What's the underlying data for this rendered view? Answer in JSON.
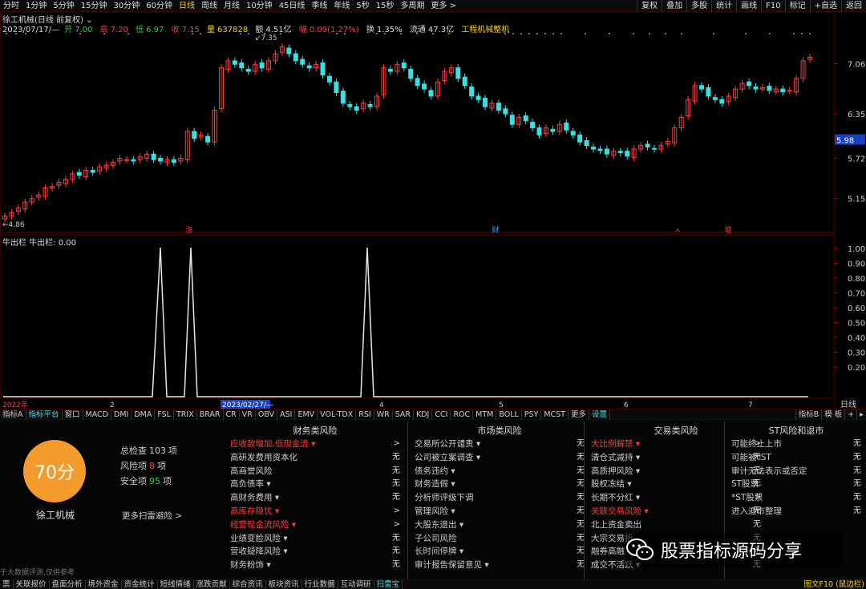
{
  "timeframes": [
    {
      "label": "分时",
      "active": false
    },
    {
      "label": "1分钟",
      "active": false
    },
    {
      "label": "5分钟",
      "active": false
    },
    {
      "label": "15分钟",
      "active": false
    },
    {
      "label": "30分钟",
      "active": false
    },
    {
      "label": "60分钟",
      "active": false
    },
    {
      "label": "日线",
      "active": true
    },
    {
      "label": "周线",
      "active": false
    },
    {
      "label": "月线",
      "active": false
    },
    {
      "label": "10分钟",
      "active": false
    },
    {
      "label": "45日线",
      "active": false
    },
    {
      "label": "季线",
      "active": false
    },
    {
      "label": "年线",
      "active": false
    },
    {
      "label": "5秒",
      "active": false
    },
    {
      "label": "15秒",
      "active": false
    },
    {
      "label": "多周期",
      "active": false
    },
    {
      "label": "更多 >",
      "active": false
    }
  ],
  "toolbar_right": [
    "复权",
    "叠加",
    "多股",
    "统计",
    "画线",
    "F10",
    "标记",
    "+自选",
    "返回"
  ],
  "stock_title": "徐工机械(日线 前复权) ⌄",
  "quote": {
    "date": "2023/07/17/—",
    "open_label": "开",
    "open": "7.00",
    "high_label": "高",
    "high": "7.20",
    "low_label": "低",
    "low": "6.97",
    "close_label": "收",
    "close": "7.15",
    "volume_label": "量",
    "volume": "637828",
    "amount_label": "额",
    "amount": "4.51亿",
    "change_label": "幅",
    "change": "0.09(1.27%)",
    "turnover_label": "换",
    "turnover": "1.35%",
    "float_label": "流通",
    "float": "47.3亿",
    "sector": "工程机械整机"
  },
  "price_axis": [
    "7.06",
    "6.35",
    "5.98",
    "5.72",
    "5.15"
  ],
  "price_marks": {
    "high": "7.35",
    "low": "4.86"
  },
  "event_marks": [
    "涨",
    "财",
    "ㅅ",
    "增"
  ],
  "indicator_title": "牛出栏  牛出栏: 0.00",
  "indicator_axis": [
    "1.00",
    "0.90",
    "0.80",
    "0.70",
    "0.60",
    "0.50",
    "0.40",
    "0.30",
    "0.20"
  ],
  "time_axis": {
    "start": "2022年",
    "labels": [
      "2",
      "2023/02/27/—",
      "4",
      "5",
      "6",
      "7"
    ],
    "right": "日线"
  },
  "indicator_tabs": [
    {
      "label": "指标A",
      "cls": ""
    },
    {
      "label": "指标平台",
      "cls": "active"
    },
    {
      "label": "窗口",
      "cls": ""
    },
    {
      "label": "MACD",
      "cls": ""
    },
    {
      "label": "DMI",
      "cls": ""
    },
    {
      "label": "DMA",
      "cls": ""
    },
    {
      "label": "FSL",
      "cls": ""
    },
    {
      "label": "TRIX",
      "cls": ""
    },
    {
      "label": "BRAR",
      "cls": ""
    },
    {
      "label": "CR",
      "cls": ""
    },
    {
      "label": "VR",
      "cls": ""
    },
    {
      "label": "OBV",
      "cls": ""
    },
    {
      "label": "ASI",
      "cls": ""
    },
    {
      "label": "EMV",
      "cls": ""
    },
    {
      "label": "VOL-TDX",
      "cls": ""
    },
    {
      "label": "RSI",
      "cls": ""
    },
    {
      "label": "WR",
      "cls": ""
    },
    {
      "label": "SAR",
      "cls": ""
    },
    {
      "label": "KDJ",
      "cls": ""
    },
    {
      "label": "CCI",
      "cls": ""
    },
    {
      "label": "ROC",
      "cls": ""
    },
    {
      "label": "MTM",
      "cls": ""
    },
    {
      "label": "BOLL",
      "cls": ""
    },
    {
      "label": "PSY",
      "cls": ""
    },
    {
      "label": "MCST",
      "cls": ""
    },
    {
      "label": "更多",
      "cls": ""
    },
    {
      "label": "设置",
      "cls": "active"
    }
  ],
  "indicator_tabs_right": [
    "指标B",
    "模 板",
    "+",
    "▸"
  ],
  "risk": {
    "score": "70分",
    "stock_name": "徐工机械",
    "total_label": "总检查",
    "total": "103",
    "total_unit": "项",
    "risk_label": "风险项",
    "risk_count": "8",
    "risk_unit": "项",
    "safe_label": "安全项",
    "safe_count": "95",
    "safe_unit": "项",
    "more": "更多扫雷避险 >",
    "disclaimer": "于大数据评测,仅供参考"
  },
  "risk_columns": [
    {
      "title": "财务类风险",
      "rows": [
        {
          "label": "应收款增加,低现金流 ▾",
          "value": ">",
          "red": true
        },
        {
          "label": "高研发费用资本化",
          "value": "无",
          "red": false
        },
        {
          "label": "高商誉风险",
          "value": "无",
          "red": false
        },
        {
          "label": "高负债率 ▾",
          "value": "无",
          "red": false
        },
        {
          "label": "高财务费用 ▾",
          "value": "无",
          "red": false
        },
        {
          "label": "高库存隐忧 ▾",
          "value": ">",
          "red": true
        },
        {
          "label": "经营现金流风险 ▾",
          "value": ">",
          "red": true
        },
        {
          "label": "业绩变脸风险 ▾",
          "value": "无",
          "red": false
        },
        {
          "label": "营收疑降风险 ▾",
          "value": "无",
          "red": false
        },
        {
          "label": "财务粉饰 ▾",
          "value": "无",
          "red": false
        }
      ]
    },
    {
      "title": "市场类风险",
      "rows": [
        {
          "label": "交易所公开谴责 ▾",
          "value": "无",
          "red": false
        },
        {
          "label": "公司被立案调查 ▾",
          "value": "无",
          "red": false
        },
        {
          "label": "债务违约 ▾",
          "value": "无",
          "red": false
        },
        {
          "label": "财务造假 ▾",
          "value": "无",
          "red": false
        },
        {
          "label": "分析师评级下调",
          "value": "无",
          "red": false
        },
        {
          "label": "管理风险 ▾",
          "value": "无",
          "red": false
        },
        {
          "label": "大股东退出 ▾",
          "value": "无",
          "red": false
        },
        {
          "label": "子公司风险",
          "value": "无",
          "red": false
        },
        {
          "label": "长时间停牌 ▾",
          "value": "无",
          "red": false
        },
        {
          "label": "审计报告保留意见 ▾",
          "value": "无",
          "red": false
        }
      ]
    },
    {
      "title": "交易类风险",
      "rows": [
        {
          "label": "大比例解禁 ▾",
          "value": ">",
          "red": true
        },
        {
          "label": "清仓式减持 ▾",
          "value": "无",
          "red": false
        },
        {
          "label": "高质押风险 ▾",
          "value": "无",
          "red": false
        },
        {
          "label": "股权冻结 ▾",
          "value": "无",
          "red": false
        },
        {
          "label": "长期不分红 ▾",
          "value": ">",
          "red": false
        },
        {
          "label": "关联交易风险 ▾",
          "value": "无",
          "red": true
        },
        {
          "label": "北上资金卖出",
          "value": "无",
          "red": false
        },
        {
          "label": "大宗交易折",
          "value": "无",
          "red": false
        },
        {
          "label": "融券高融",
          "value": "无",
          "red": false
        },
        {
          "label": "成交不活跃 ▾",
          "value": "无",
          "red": false
        }
      ]
    },
    {
      "title": "ST风险和退市",
      "rows": [
        {
          "label": "可能终止上市",
          "value": "无",
          "red": false
        },
        {
          "label": "可能被*ST",
          "value": "无",
          "red": false
        },
        {
          "label": "审计无法表示或否定",
          "value": "无",
          "red": false
        },
        {
          "label": "ST股票",
          "value": "无",
          "red": false
        },
        {
          "label": "*ST股票",
          "value": "无",
          "red": false
        },
        {
          "label": "进入退市整理",
          "value": "无",
          "red": false
        }
      ]
    }
  ],
  "bottom_tabs": [
    {
      "label": "票",
      "cls": ""
    },
    {
      "label": "关联报价",
      "cls": ""
    },
    {
      "label": "盘面分析",
      "cls": ""
    },
    {
      "label": "境外资金",
      "cls": ""
    },
    {
      "label": "资金统计",
      "cls": ""
    },
    {
      "label": "短线情绪",
      "cls": ""
    },
    {
      "label": "涨跌贡献",
      "cls": ""
    },
    {
      "label": "综合资讯",
      "cls": ""
    },
    {
      "label": "板块资讯",
      "cls": ""
    },
    {
      "label": "行业数据",
      "cls": ""
    },
    {
      "label": "互动调研",
      "cls": ""
    },
    {
      "label": "扫雷宝",
      "cls": "active"
    }
  ],
  "bottom_right": "图文F10 (鼠边栏)",
  "watermark": "股票指标源码分享",
  "colors": {
    "up": "#ff3c3c",
    "down": "#38e0e0",
    "accent": "#ffd200",
    "score_bg": "#f39c2d"
  }
}
